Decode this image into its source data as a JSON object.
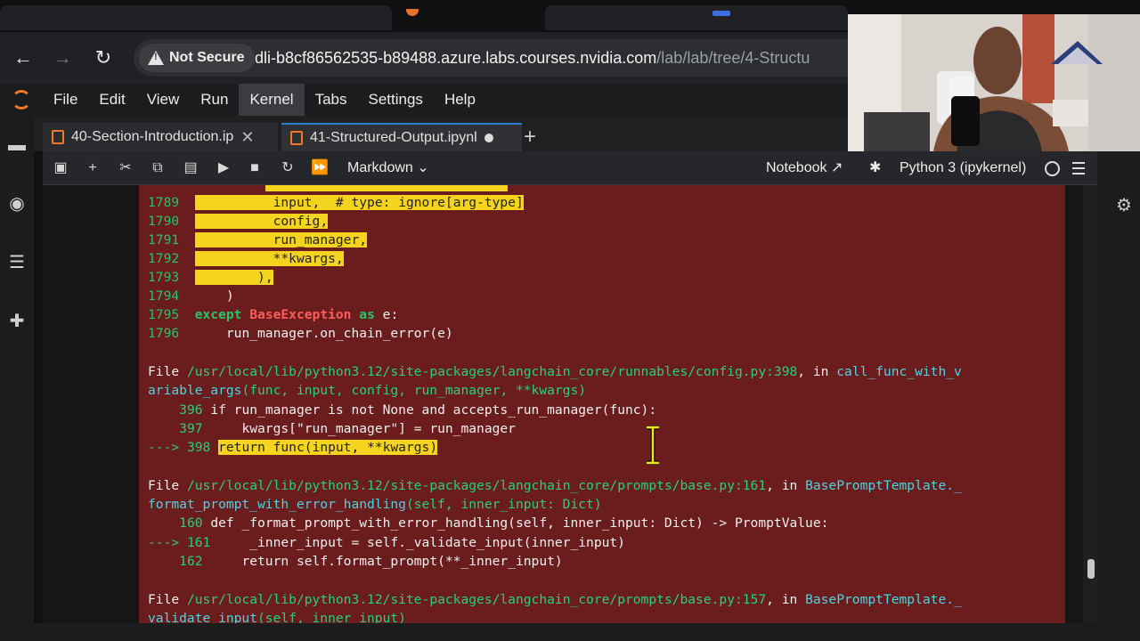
{
  "browser": {
    "security_label": "Not Secure",
    "url_host": "dli-b8cf86562535-b89488.azure.labs.courses.nvidia.com",
    "url_path": "/lab/lab/tree/4-Structu"
  },
  "menubar": {
    "items": [
      "File",
      "Edit",
      "View",
      "Run",
      "Kernel",
      "Tabs",
      "Settings",
      "Help"
    ],
    "active": "Kernel"
  },
  "tabs": [
    {
      "label": "40-Section-Introduction.ip",
      "close": "✕"
    },
    {
      "label": "41-Structured-Output.ipynl"
    }
  ],
  "toolbar": {
    "cell_type": "Markdown",
    "notebook_label": "Notebook",
    "kernel_label": "Python 3 (ipykernel)"
  },
  "traceback": {
    "lines": [
      {
        "num": "1789",
        "text": "input,  # type: ignore[arg-type]"
      },
      {
        "num": "1790",
        "text": "config,"
      },
      {
        "num": "1791",
        "text": "run_manager,"
      },
      {
        "num": "1792",
        "text": "**kwargs,"
      },
      {
        "num": "1793",
        "text": "),"
      },
      {
        "num": "1794",
        "text": ")"
      },
      {
        "num": "1795",
        "kw": "except",
        "ex": "BaseException",
        "as": "as",
        "var": "e:"
      },
      {
        "num": "1796",
        "text": "run_manager.on_chain_error(e)"
      }
    ],
    "frames": [
      {
        "file_kw": "File",
        "path": "/usr/local/lib/python3.12/site-packages/langchain_core/runnables/config.py:398",
        "in": ", in ",
        "func_line1": "call_func_with_v",
        "func_line2": "ariable_args",
        "sig": "(func, input, config, run_manager, **kwargs)",
        "code": [
          {
            "num": "396",
            "text": "if run_manager is not None and accepts_run_manager(func):"
          },
          {
            "num": "397",
            "text": "kwargs[\"run_manager\"] = run_manager"
          },
          {
            "num": "398",
            "marker": "---> ",
            "text": "return func(input, **kwargs)"
          }
        ]
      },
      {
        "file_kw": "File",
        "path": "/usr/local/lib/python3.12/site-packages/langchain_core/prompts/base.py:161",
        "in": ", in ",
        "func_line1": "BasePromptTemplate._",
        "func_line2": "format_prompt_with_error_handling",
        "sig": "(self, inner_input: Dict)",
        "code": [
          {
            "num": "160",
            "text": "def _format_prompt_with_error_handling(self, inner_input: Dict) -> PromptValue:"
          },
          {
            "num": "161",
            "marker": "---> ",
            "text": "_inner_input = self._validate_input(inner_input)"
          },
          {
            "num": "162",
            "text": "return self.format_prompt(**_inner_input)"
          }
        ]
      },
      {
        "file_kw": "File",
        "path": "/usr/local/lib/python3.12/site-packages/langchain_core/prompts/base.py:157",
        "in": ", in ",
        "func_line1": "BasePromptTemplate._",
        "func_line2": "validate_input",
        "sig": "(self, inner_input)"
      }
    ]
  }
}
